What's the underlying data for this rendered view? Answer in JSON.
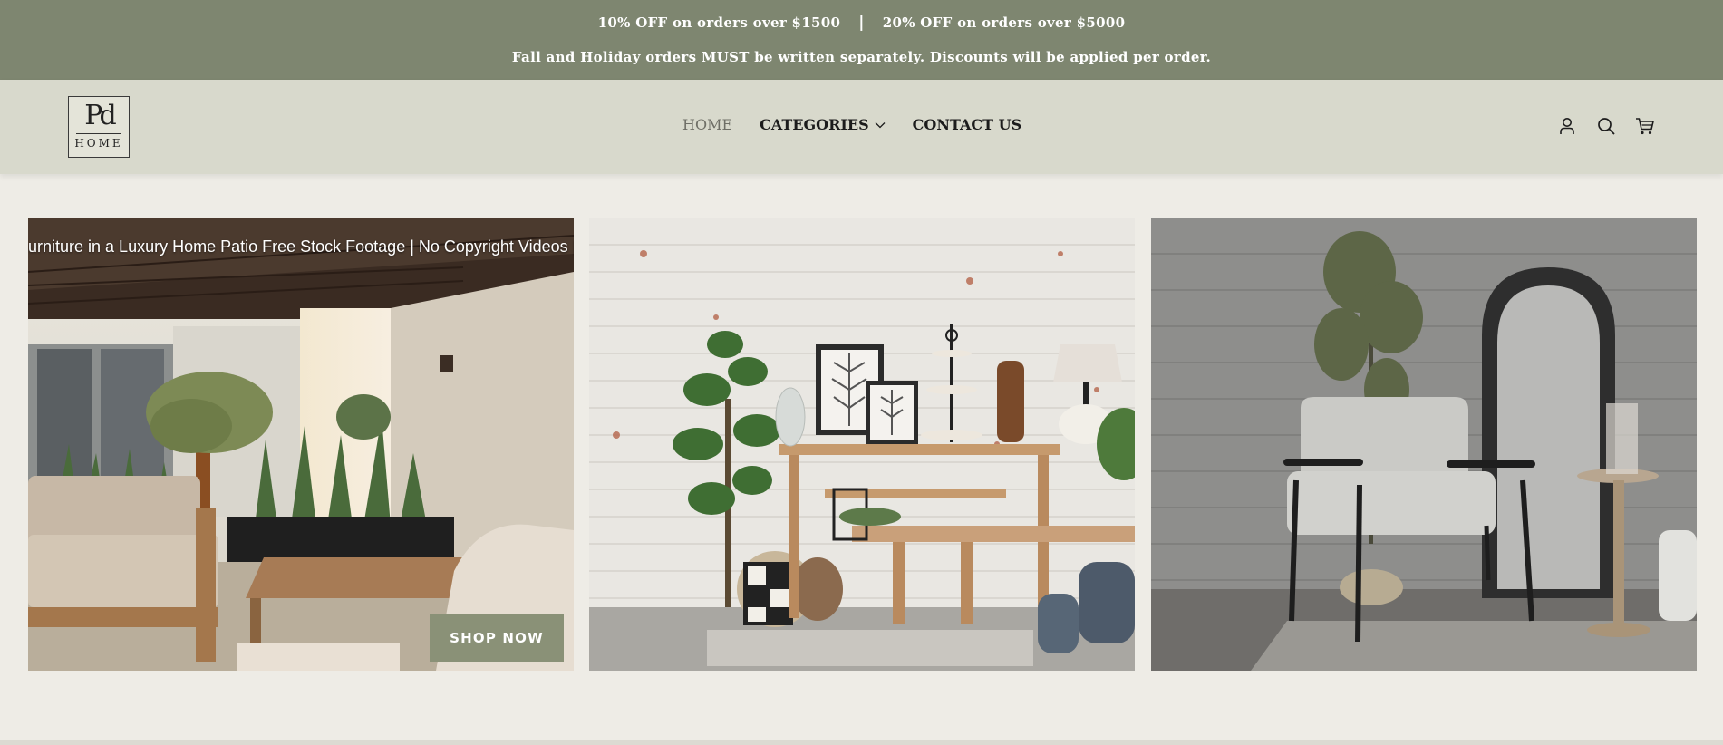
{
  "announcement": {
    "offer1": "10% OFF on orders over $1500",
    "separator": "|",
    "offer2": "20% OFF on orders over $5000",
    "notice": "Fall and Holiday orders MUST be written separately. Discounts will be applied per order."
  },
  "logo": {
    "monogram": "Pd",
    "word": "HOME"
  },
  "nav": {
    "home": "HOME",
    "categories": "CATEGORIES",
    "contact": "CONTACT US"
  },
  "header_icons": [
    "account-icon",
    "search-icon",
    "cart-icon"
  ],
  "tiles": {
    "video_title": "urniture in a Luxury Home Patio Free Stock Footage | No Copyright Videos | C",
    "shop_now": "SHOP NOW"
  },
  "colors": {
    "announcement_bg": "#7e8670",
    "header_bg": "#d8d9cc",
    "page_bg": "#eeece6",
    "button_bg": "#8a9177"
  }
}
